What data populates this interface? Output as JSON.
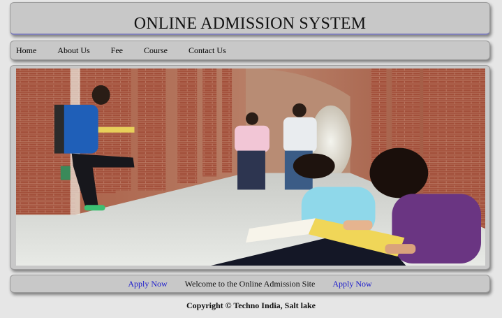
{
  "header": {
    "title": "ONLINE ADMISSION SYSTEM"
  },
  "nav": {
    "items": [
      {
        "label": "Home"
      },
      {
        "label": "About Us"
      },
      {
        "label": "Fee"
      },
      {
        "label": "Course"
      },
      {
        "label": "Contact Us"
      }
    ]
  },
  "banner": {
    "alt": "Students studying in a brick arched corridor"
  },
  "footer_bar": {
    "left_link": "Apply Now",
    "message": "Welcome to the Online Admission Site",
    "right_link": "Apply Now"
  },
  "copyright": "Copyright © Techno India, Salt lake",
  "colors": {
    "panel_bg": "#c8c8c8",
    "page_bg": "#e6e6e6",
    "link": "#1a1acc",
    "header_underline": "#8080b8"
  }
}
